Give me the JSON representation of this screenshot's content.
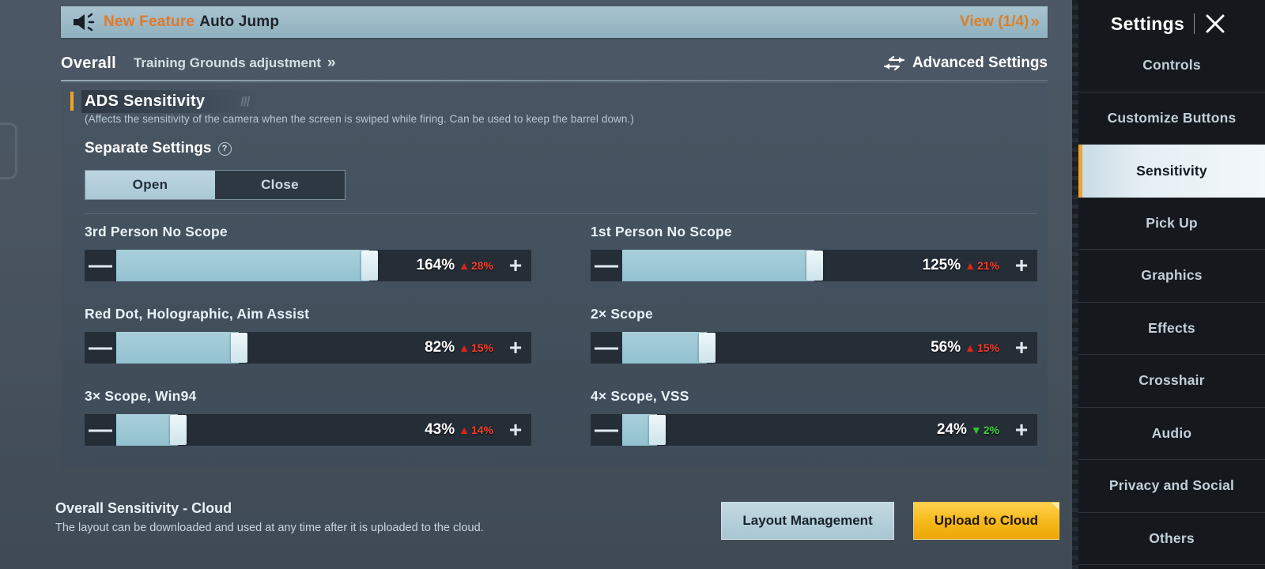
{
  "announcement": {
    "icon": "megaphone-icon",
    "badge": "New Feature",
    "text": "Auto Jump",
    "view_label": "View (1/4)",
    "view_chevron": "»"
  },
  "tabs": {
    "overall": "Overall",
    "training": "Training Grounds adjustment",
    "training_chevron": "»",
    "advanced": "Advanced Settings",
    "advanced_icon": "swap-arrows-icon"
  },
  "section": {
    "title": "ADS Sensitivity",
    "description": "(Affects the sensitivity of the camera when the screen is swiped while firing. Can be used to keep the barrel down.)",
    "separate_label": "Separate Settings",
    "help_icon": "?",
    "toggle": {
      "open": "Open",
      "close": "Close",
      "selected": "Open"
    },
    "accent_color": "#f0a428"
  },
  "sliders": [
    {
      "label": "3rd Person No Scope",
      "value": "164%",
      "fill_pct": 66,
      "delta": "28%",
      "direction": "up",
      "minus": "—",
      "plus": "+"
    },
    {
      "label": "1st Person No Scope",
      "value": "125%",
      "fill_pct": 50,
      "delta": "21%",
      "direction": "up",
      "minus": "—",
      "plus": "+"
    },
    {
      "label": "Red Dot, Holographic, Aim Assist",
      "value": "82%",
      "fill_pct": 32,
      "delta": "15%",
      "direction": "up",
      "minus": "—",
      "plus": "+"
    },
    {
      "label": "2× Scope",
      "value": "56%",
      "fill_pct": 22,
      "delta": "15%",
      "direction": "up",
      "minus": "—",
      "plus": "+"
    },
    {
      "label": "3× Scope, Win94",
      "value": "43%",
      "fill_pct": 16,
      "delta": "14%",
      "direction": "up",
      "minus": "—",
      "plus": "+"
    },
    {
      "label": "4× Scope, VSS",
      "value": "24%",
      "fill_pct": 9,
      "delta": "2%",
      "direction": "down",
      "minus": "—",
      "plus": "+"
    }
  ],
  "footer": {
    "title": "Overall Sensitivity - Cloud",
    "description": "The layout can be downloaded and used at any time after it is uploaded to the cloud.",
    "layout_button": "Layout Management",
    "upload_button": "Upload to Cloud",
    "upload_color": "#f5b719"
  },
  "sidebar": {
    "title": "Settings",
    "close_icon": "close-icon",
    "items": [
      {
        "label": "Controls",
        "active": false
      },
      {
        "label": "Customize Buttons",
        "active": false
      },
      {
        "label": "Sensitivity",
        "active": true
      },
      {
        "label": "Pick Up",
        "active": false
      },
      {
        "label": "Graphics",
        "active": false
      },
      {
        "label": "Effects",
        "active": false
      },
      {
        "label": "Crosshair",
        "active": false
      },
      {
        "label": "Audio",
        "active": false
      },
      {
        "label": "Privacy and Social",
        "active": false
      },
      {
        "label": "Others",
        "active": false
      }
    ]
  }
}
